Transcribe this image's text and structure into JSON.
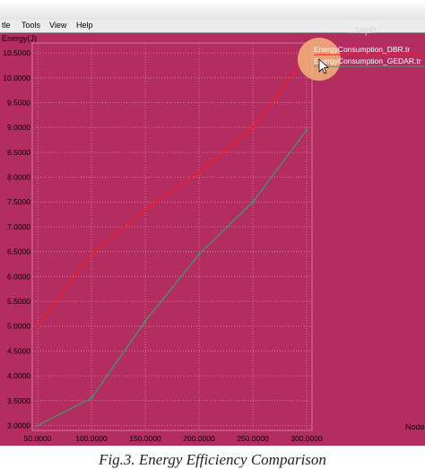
{
  "menu": {
    "items": [
      "tle",
      "Tools",
      "View",
      "Help"
    ]
  },
  "window": {
    "top_right_label": "...raph"
  },
  "caption": "Fig.3. Energy Efficiency Comparison",
  "colors": {
    "background": "#b42d60",
    "grid": "#d47a9a",
    "series_dbr": "#ff1a1a",
    "series_gedar": "#2ea36a",
    "highlight": "#f2b57a"
  },
  "chart_data": {
    "type": "line",
    "title": "",
    "ylabel": "Energy(J)",
    "xlabel": "Nodes",
    "x": [
      50,
      100,
      150,
      200,
      250,
      300
    ],
    "x_tick_labels": [
      "50.0000",
      "100.0000",
      "150.0000",
      "200.0000",
      "250.0000",
      "300.0000"
    ],
    "y_tick_labels": [
      "3.0000",
      "3.5000",
      "4.0000",
      "4.5000",
      "5.0000",
      "5.5000",
      "6.0000",
      "6.5000",
      "7.0000",
      "7.5000",
      "8.0000",
      "8.5000",
      "9.0000",
      "9.5000",
      "10.0000",
      "10.5000"
    ],
    "ylim": [
      2.9,
      10.7
    ],
    "grid": true,
    "legend_position": "top-right",
    "series": [
      {
        "name": "EnergyConsumption_DBR.tr",
        "values": [
          5.0,
          6.45,
          7.35,
          8.1,
          9.0,
          10.45
        ]
      },
      {
        "name": "EnergyConsumption_GEDAR.tr",
        "values": [
          3.0,
          3.55,
          5.1,
          6.45,
          7.5,
          8.95
        ]
      }
    ]
  }
}
